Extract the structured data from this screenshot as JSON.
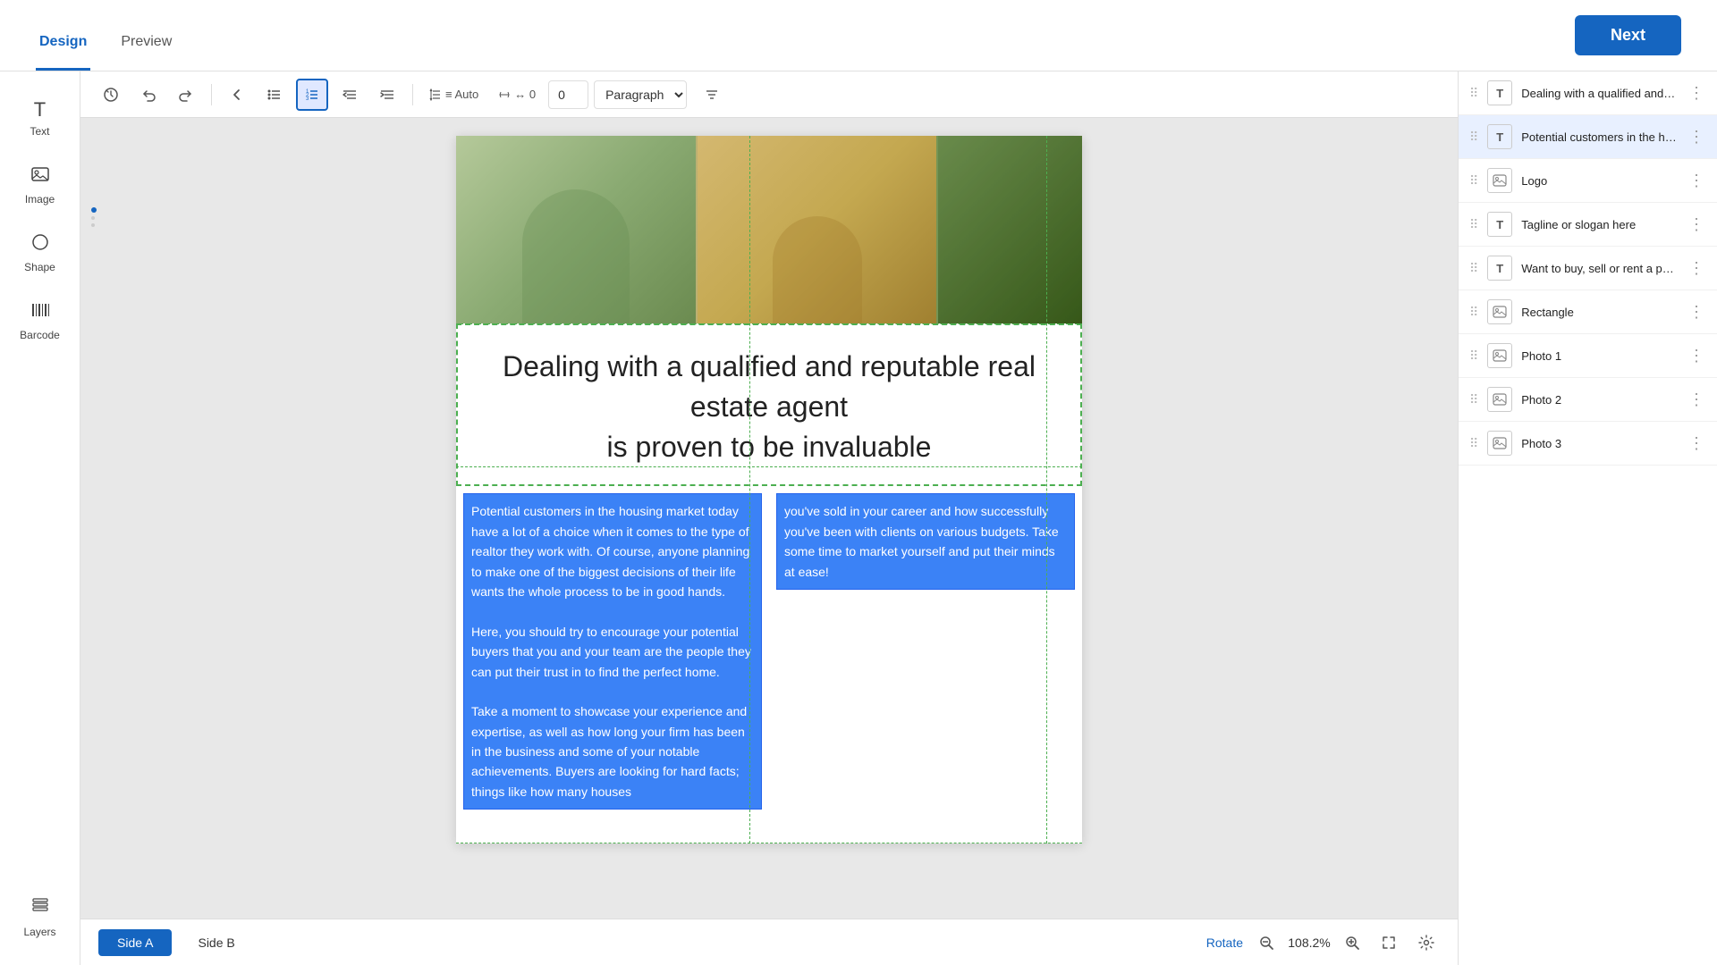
{
  "header": {
    "logo": "✦",
    "tabs": [
      {
        "label": "Design",
        "active": true
      },
      {
        "label": "Preview",
        "active": false
      }
    ],
    "next_button": "Next"
  },
  "toolbar": {
    "buttons": [
      {
        "id": "undo-history",
        "icon": "↺",
        "title": "History",
        "active": false
      },
      {
        "id": "undo",
        "icon": "↩",
        "title": "Undo",
        "active": false
      },
      {
        "id": "redo",
        "icon": "↪",
        "title": "Redo",
        "active": false
      },
      {
        "id": "prev-page",
        "icon": "‹",
        "title": "Previous page",
        "active": false
      },
      {
        "id": "bullet-list",
        "icon": "≡",
        "title": "Bullet list",
        "active": false
      },
      {
        "id": "numbered-list",
        "icon": "⋮",
        "title": "Numbered list",
        "active": true
      },
      {
        "id": "indent-left",
        "icon": "⇤",
        "title": "Decrease indent",
        "active": false
      },
      {
        "id": "indent-right",
        "icon": "⇥",
        "title": "Increase indent",
        "active": false
      }
    ],
    "line_spacing_label": "≡ Auto",
    "char_spacing_label": "↔ 0",
    "paragraph_style": "Paragraph",
    "filter_icon": "⊟"
  },
  "left_sidebar": {
    "tools": [
      {
        "id": "text",
        "icon": "T",
        "label": "Text"
      },
      {
        "id": "image",
        "icon": "🖼",
        "label": "Image"
      },
      {
        "id": "shape",
        "icon": "◯",
        "label": "Shape"
      },
      {
        "id": "barcode",
        "icon": "▦",
        "label": "Barcode"
      },
      {
        "id": "layers",
        "icon": "⧉",
        "label": "Layers"
      }
    ]
  },
  "canvas": {
    "heading": "Dealing with a qualified and reputable real estate agent\nis proven to be invaluable",
    "body_left": "Potential customers in the housing market today have a lot of a choice when it comes to the type of realtor they work with. Of course, anyone planning to make one of the biggest decisions of their life wants the whole process to be in good hands.\nHere, you should try to encourage your potential buyers that you and your team are the people they can put their trust in to find the perfect home.\nTake a moment to showcase your experience and expertise, as well as how long your firm has been in the business and some of your notable achievements. Buyers are looking for hard facts; things like how many houses",
    "body_right": "you've sold in your career and how successfully you've been with clients on various budgets. Take some time to market yourself and put their minds at ease!"
  },
  "right_panel": {
    "layers": [
      {
        "id": "layer-heading",
        "type": "T",
        "name": "Dealing with a qualified and reputable real estate agent is proven to be invaluable",
        "active": false,
        "is_image": false
      },
      {
        "id": "layer-potential",
        "type": "T",
        "name": "Potential customers in the housing ...",
        "active": true,
        "is_image": false
      },
      {
        "id": "layer-logo",
        "type": "img",
        "name": "Logo",
        "active": false,
        "is_image": true
      },
      {
        "id": "layer-tagline",
        "type": "T",
        "name": "Tagline or slogan here",
        "active": false,
        "is_image": false
      },
      {
        "id": "layer-want",
        "type": "T",
        "name": "Want to buy, sell or rent a property?",
        "active": false,
        "is_image": false
      },
      {
        "id": "layer-rectangle",
        "type": "img",
        "name": "Rectangle",
        "active": false,
        "is_image": true
      },
      {
        "id": "layer-photo1",
        "type": "img",
        "name": "Photo 1",
        "active": false,
        "is_image": true
      },
      {
        "id": "layer-photo2",
        "type": "img",
        "name": "Photo 2",
        "active": false,
        "is_image": true
      },
      {
        "id": "layer-photo3",
        "type": "img",
        "name": "Photo 3",
        "active": false,
        "is_image": true
      }
    ]
  },
  "bottom": {
    "side_a_label": "Side A",
    "side_b_label": "Side B",
    "rotate_label": "Rotate",
    "zoom_level": "108.2%",
    "zoom_in_title": "Zoom in",
    "zoom_out_title": "Zoom out",
    "fullscreen_title": "Fullscreen",
    "settings_title": "Settings"
  }
}
